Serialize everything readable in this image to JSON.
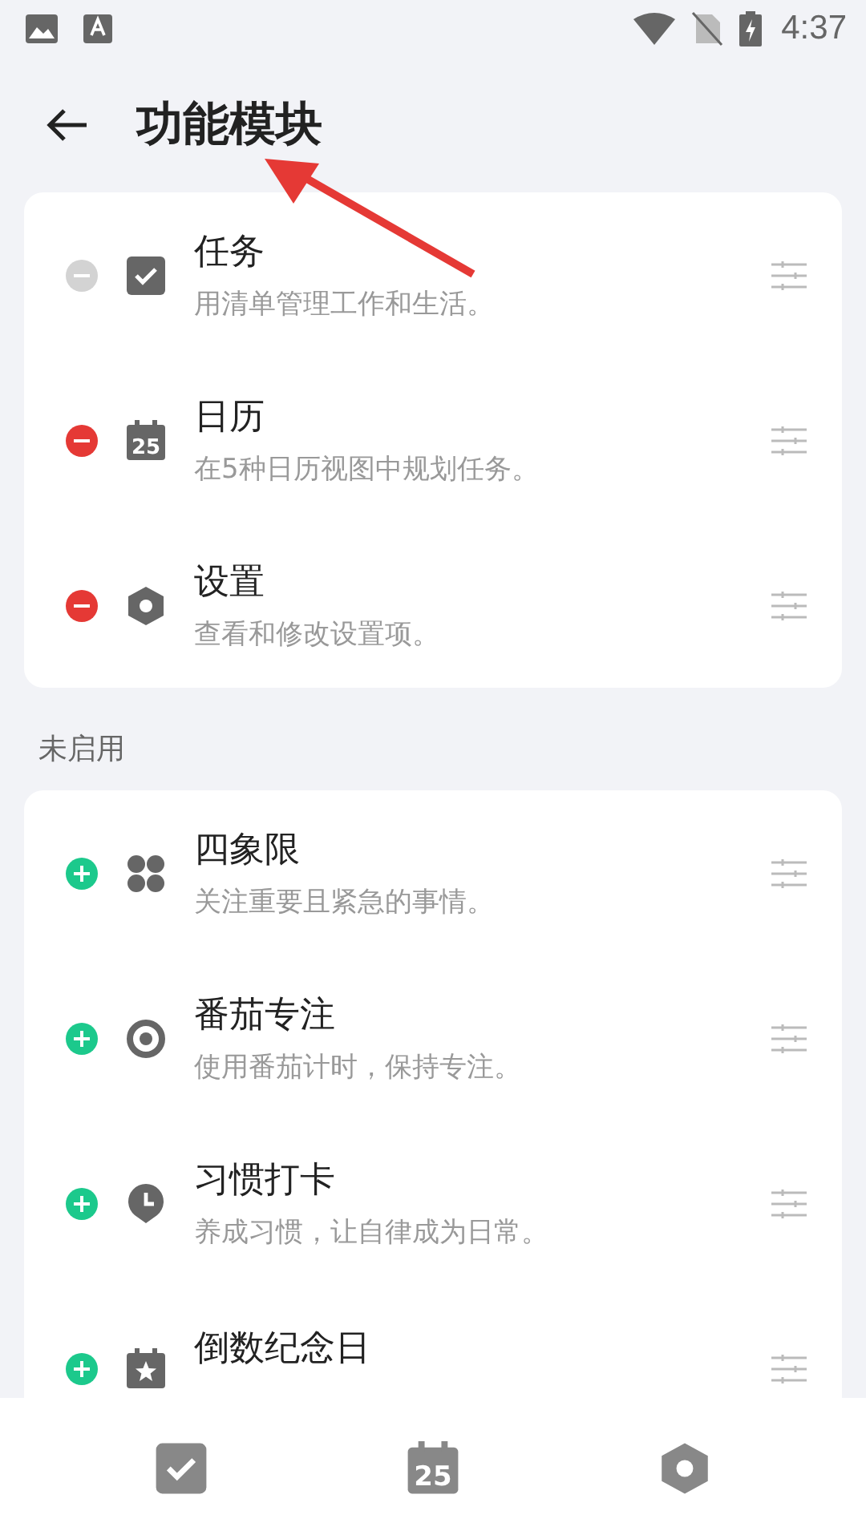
{
  "status_bar": {
    "time": "4:37"
  },
  "header": {
    "title": "功能模块"
  },
  "enabled_modules": [
    {
      "title": "任务",
      "description": "用清单管理工作和生活。",
      "kind": "check",
      "disabled": true
    },
    {
      "title": "日历",
      "description": "在5种日历视图中规划任务。",
      "kind": "calendar",
      "icon_text": "25",
      "disabled": false
    },
    {
      "title": "设置",
      "description": "查看和修改设置项。",
      "kind": "hexagon",
      "disabled": false
    }
  ],
  "disabled_section": {
    "label": "未启用"
  },
  "disabled_modules": [
    {
      "title": "四象限",
      "description": "关注重要且紧急的事情。",
      "kind": "clover"
    },
    {
      "title": "番茄专注",
      "description": "使用番茄计时，保持专注。",
      "kind": "ring"
    },
    {
      "title": "习惯打卡",
      "description": "养成习惯，让自律成为日常。",
      "kind": "clock"
    },
    {
      "title": "倒数纪念日",
      "kind": "star"
    }
  ],
  "bottom_nav": [
    {
      "kind": "check"
    },
    {
      "kind": "calendar",
      "icon_text": "25"
    },
    {
      "kind": "hexagon"
    }
  ]
}
